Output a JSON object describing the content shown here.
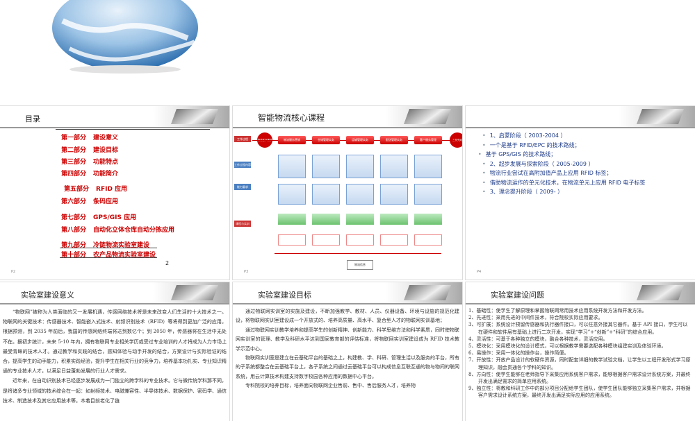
{
  "slide2": {
    "title": "目录",
    "page_number": "2",
    "page_label": "P2",
    "toc": [
      {
        "part": "第一部分",
        "name": "建设意义"
      },
      {
        "part": "第二部分",
        "name": "建设目标"
      },
      {
        "part": "第三部分",
        "name": "功能特点"
      },
      {
        "part": "第四部分",
        "name": "功能简介"
      },
      {
        "part": "第五部分",
        "name": "RFID 应用"
      },
      {
        "part": "第六部分",
        "name": "条码应用"
      },
      {
        "part": "第七部分",
        "name": "GPS/GIS 应用"
      },
      {
        "part": "第八部分",
        "name": "自动化立体仓库自动分拣应用"
      },
      {
        "part": "第九部分",
        "name": "冷链物流实验室建设"
      },
      {
        "part": "第十部分",
        "name": "农产品物流实验室建设"
      }
    ]
  },
  "slide3": {
    "title": "智能物流核心课程",
    "page_label": "P3",
    "lanes": [
      "工作过程",
      "工作过程内容",
      "能力要求",
      "课程与实训"
    ],
    "stages": [
      "物流服务营销",
      "仓储管理实务",
      "运输管理实务",
      "配送管理实务",
      "客户服务管理"
    ],
    "start_label": "物流客户需求",
    "end_label": "工作完成",
    "bottom_label": "物流信息"
  },
  "slide4": {
    "page_label": "P4",
    "bullets": [
      "1、启蒙阶段（ 2003-2004 ）",
      "一个是基于 RFID/EPC 的技术路线；",
      "基于 GPS/GIS 的技术路线；",
      "2、起步发展与探索阶段（ 2005-2009 ）",
      "物流行业尝试在高附加值产品上应用 RFID 标签；",
      "借助物流运作的单元化技术，在物流单元上应用 RFID 电子标签",
      "3、理念提升阶段（ 2009- ）"
    ]
  },
  "slide5": {
    "title": "实验室建设意义",
    "paragraphs": [
      "“物联网”被称为人类面临的又一发展机遇，传感网络技术将是未来改变人们生活的十大技术之一。物联网的关键技术：传感器技术、智能嵌入式技术、射频识别技术（RFID）等将得到更加广泛的应用。根据预测，到 2035 年前后，我国的传感网络终端将达到数亿个；到 2050 年，传感器将在生活中无处不在。据初步统计，未来 5-10 年内，拥有物联网专业相关学历或受过专业培训的人才将成为人力市场上最受青睐的技术人才。通过教学和实践的结合，感知体验与动手开发的结合，方案设计与实际验证的结合，提高学生的动手能力，积累实践经验，提升学生在相关行业的竞争力，培养基本功扎实、专业知识精通的专业技术人才，以满足日益蓬勃发展的行业人才需求。",
      "近年来，在自动识别技术已经逐步发展成为一门独立的跨学科的专业技术。它与微传统学科那不同，是将诸多专业领域的技术综合在一起：如射频技术、电磁兼容性、半导体技术、数据保护、密码学、通信技术、制造技术及其它应用技术等。本着目前老化了链"
    ]
  },
  "slide6": {
    "title": "实验室建设目标",
    "paragraphs": [
      "通过物联网实训室的实施及建设，不断加强教学、教材、人员、仪器设备、环境与设施的规范化建设，将物联网实训室建设成一个开放式的、培养高质量、高水平、复合型人才的物联网实训基地；",
      "通过物联网实训教学培养和提高学生的创新精神、创新能力、科学思维方法和科学素质，同时使物联网实训室的管理、教学及科研水平达到国家教育部的评估标准，将物联网实训室建设成为 RFID 技术教学示范中心。",
      "物联网实训室是建立在云基础平台的基础之上，构建教、学、科研、管理生活以及服务的平台，所有的子系统都整合在云基础平台上，各子系统之间通过云基础平台可以构成信息互联互通的物与物间的联网系统，用云计算技术构建支持数字校园各种应用的数据中心平台。",
      "专科院校的培养目标，培养面向物联网企业售前、售中、售后服务人才，培养物"
    ]
  },
  "slide7": {
    "title": "实验室建设问题",
    "items": [
      "1、基础性：使学生了解原理和掌握物联网常用技术应用系统开发方法和开发方法。",
      "2、先进性：采用先进的中间件技术，符合院校实际应用要求。",
      "3、可扩展：系统设计预留传感器和执行器件接口，可以任意外接其它器件。基于 API 接口，学生可以在硬件和软件层有基础上进行二次开发，实现“学习”+“创新”+“科研”的综合应用。",
      "4、灵活性：可基于各种独立的模块，融合各种技术，灵活应用。",
      "5、模块化：采用模块化的设计模式，可以根据教学需要选配各种模块组建实训及体验环境。",
      "6、易操作：采用一体化的操作台，操作简便。",
      "7、开放性：开放产品设计的软硬件资源，同时配套详细的教学试验文档，让学生以工程开发形式学习原理知识，融会贯通各个学科的知识。",
      "8、方向性：使学生能够在老师指导下采集应用系统客户需求，能够根据客户需求设计系统方案，并最终开发出满足需求的简单应用系统。",
      "9、独立性：将教和科研工作中的部分项目分配给学生团队，使学生团队能够独立采集客户需求，并根据客户需求设计系统方案，最终开发出满足实际应用的应用系统。"
    ]
  }
}
